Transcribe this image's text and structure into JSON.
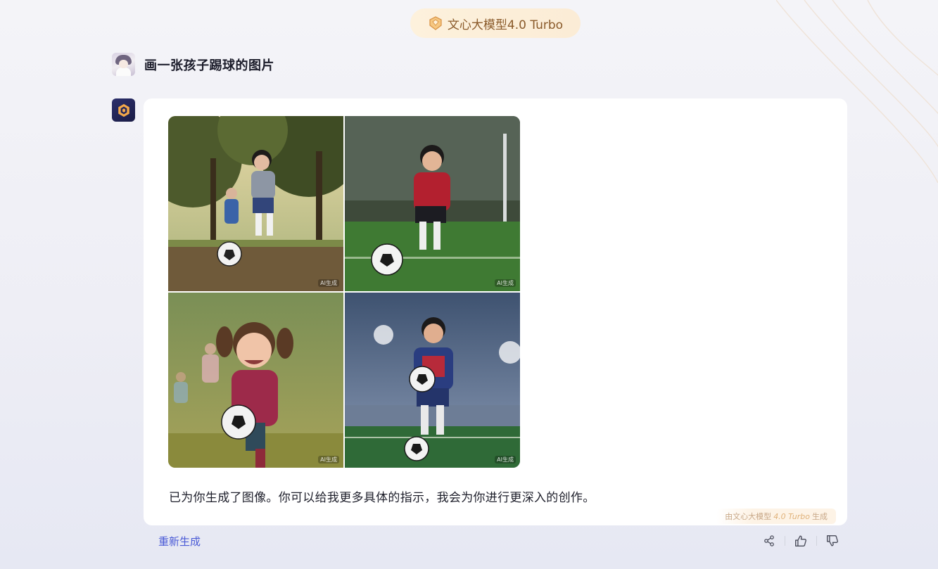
{
  "model_badge": {
    "label": "文心大模型4.0 Turbo",
    "icon": "diamond-icon"
  },
  "user_message": {
    "text": "画一张孩子踢球的图片",
    "avatar": "user-avatar"
  },
  "bot_response": {
    "avatar": "ernie-bot-logo",
    "images": [
      {
        "alt": "男孩在树下公园踢球",
        "watermark": "AI生成"
      },
      {
        "alt": "穿红色球衣的男孩在草地上踢球",
        "watermark": "AI生成"
      },
      {
        "alt": "扎辫子的小女孩追着足球奔跑",
        "watermark": "AI生成"
      },
      {
        "alt": "男孩在体育场灯光下踢球",
        "watermark": "AI生成"
      }
    ],
    "text": "已为你生成了图像。你可以给我更多具体的指示，我会为你进行更深入的创作。",
    "generated_by": {
      "prefix": "由文心大模型",
      "model": "4.0 Turbo",
      "suffix": "生成"
    }
  },
  "actions": {
    "regenerate_label": "重新生成",
    "share_icon": "share-icon",
    "like_icon": "thumbs-up-icon",
    "dislike_icon": "thumbs-down-icon"
  },
  "colors": {
    "accent": "#4b5bd6",
    "badge_bg": "#fdf1dc",
    "badge_text": "#8a5a2a"
  }
}
